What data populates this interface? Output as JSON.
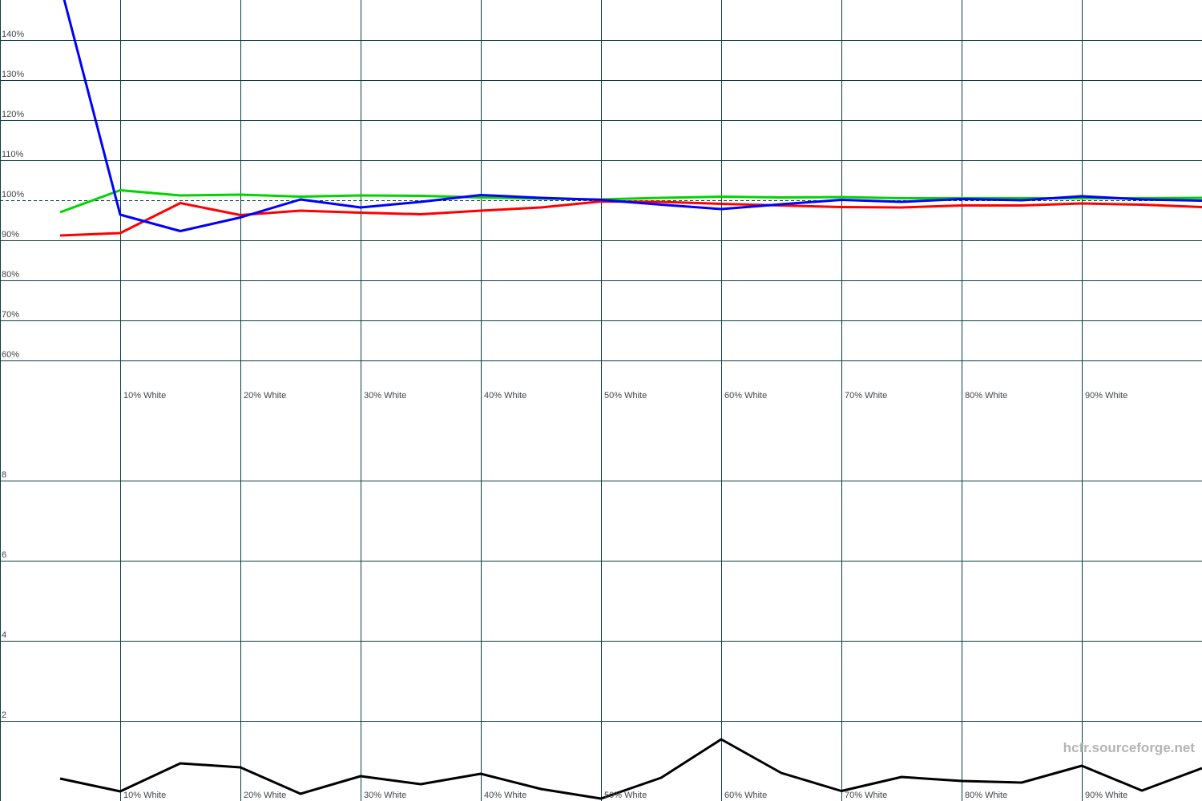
{
  "watermark": "hcfr.sourceforge.net",
  "colors": {
    "background": "#ffffff",
    "grid": "#0c3e3e",
    "tick_label": "#414549",
    "watermark": "#b4b4b4",
    "red_series": "#ff0000",
    "green_series": "#00d500",
    "blue_series": "#0000ff",
    "delta_series": "#000000"
  },
  "chart_data": [
    {
      "id": "rgb-levels",
      "type": "line",
      "x": [
        5,
        10,
        15,
        20,
        25,
        30,
        35,
        40,
        45,
        50,
        55,
        60,
        65,
        70,
        75,
        80,
        85,
        90,
        95,
        100
      ],
      "x_tick_values": [
        10,
        20,
        30,
        40,
        50,
        60,
        70,
        80,
        90
      ],
      "x_tick_labels": [
        "10% White",
        "20% White",
        "30% White",
        "40% White",
        "50% White",
        "60% White",
        "70% White",
        "80% White",
        "90% White"
      ],
      "xlim": [
        0,
        100
      ],
      "y_tick_values": [
        140,
        130,
        120,
        110,
        100,
        90,
        80,
        70,
        60
      ],
      "y_tick_labels": [
        "140%",
        "130%",
        "120%",
        "110%",
        "100%",
        "90%",
        "80%",
        "70%",
        "60%"
      ],
      "ylim": [
        60,
        150
      ],
      "reference_line_y": 100,
      "grid": true,
      "legend": "none",
      "series": [
        {
          "name": "red",
          "color_key": "red_series",
          "values": [
            91.2,
            91.8,
            99.3,
            96.3,
            97.4,
            96.9,
            96.5,
            97.4,
            98.2,
            99.7,
            99.6,
            99.1,
            98.7,
            98.3,
            98.2,
            98.7,
            98.7,
            99.2,
            98.9,
            98.3
          ]
        },
        {
          "name": "green",
          "color_key": "green_series",
          "values": [
            97.0,
            102.5,
            101.2,
            101.4,
            100.9,
            101.2,
            101.1,
            100.7,
            100.4,
            100.2,
            100.6,
            100.9,
            100.7,
            100.8,
            100.5,
            100.5,
            100.5,
            100.5,
            100.5,
            100.6
          ]
        },
        {
          "name": "blue",
          "color_key": "blue_series",
          "values": [
            154.0,
            96.4,
            92.3,
            95.7,
            100.2,
            98.2,
            99.6,
            101.3,
            100.6,
            100.1,
            98.9,
            97.8,
            99.0,
            100.1,
            99.6,
            100.3,
            100.0,
            101.0,
            100.2,
            99.9
          ]
        }
      ]
    },
    {
      "id": "delta",
      "type": "line",
      "x": [
        5,
        10,
        15,
        20,
        25,
        30,
        35,
        40,
        45,
        50,
        55,
        60,
        65,
        70,
        75,
        80,
        85,
        90,
        95,
        100
      ],
      "x_tick_values": [
        10,
        20,
        30,
        40,
        50,
        60,
        70,
        80,
        90
      ],
      "x_tick_labels": [
        "10% White",
        "20% White",
        "30% White",
        "40% White",
        "50% White",
        "60% White",
        "70% White",
        "80% White",
        "90% White"
      ],
      "xlim": [
        0,
        100
      ],
      "y_tick_values": [
        8,
        6,
        4,
        2
      ],
      "y_tick_labels": [
        "8",
        "6",
        "4",
        "2"
      ],
      "ylim": [
        0,
        10
      ],
      "grid": true,
      "legend": "none",
      "series": [
        {
          "name": "delta",
          "color_key": "delta_series",
          "values": [
            0.56,
            0.24,
            0.94,
            0.84,
            0.18,
            0.62,
            0.42,
            0.68,
            0.3,
            0.06,
            0.58,
            1.54,
            0.7,
            0.25,
            0.6,
            0.5,
            0.46,
            0.88,
            0.26,
            0.82
          ]
        }
      ]
    }
  ]
}
